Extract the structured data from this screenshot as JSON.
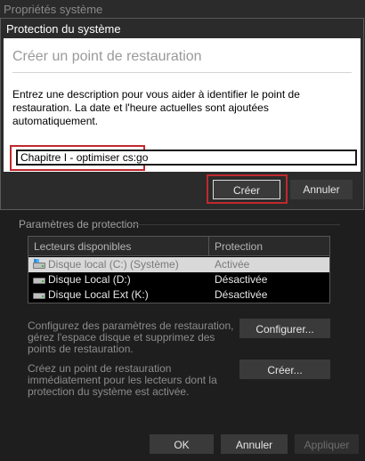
{
  "background_window": {
    "title": "Propriétés système",
    "group_label": "Paramètres de protection",
    "table": {
      "headers": [
        "Lecteurs disponibles",
        "Protection"
      ],
      "rows": [
        {
          "drive": "Disque local (C:) (Système)",
          "protection": "Activée",
          "icon": "system-drive-icon",
          "selected": true
        },
        {
          "drive": "Disque Local (D:)",
          "protection": "Désactivée",
          "icon": "drive-icon",
          "selected": false
        },
        {
          "drive": "Disque Local Ext (K:)",
          "protection": "Désactivée",
          "icon": "drive-icon",
          "selected": false
        }
      ]
    },
    "configure_text": "Configurez des paramètres de restauration, gérez l'espace disque et supprimez des points de restauration.",
    "configure_button": "Configurer...",
    "create_text": "Créez un point de restauration immédiatement pour les lecteurs dont la protection du système est activée.",
    "create_button": "Créer...",
    "ok_button": "OK",
    "cancel_button": "Annuler",
    "apply_button": "Appliquer"
  },
  "dialog": {
    "title": "Protection du système",
    "heading": "Créer un point de restauration",
    "description": "Entrez une description pour vous aider à identifier le point de restauration. La date et l'heure actuelles sont ajoutées automatiquement.",
    "input_value": "Chapitre I - optimiser cs:go",
    "create_button": "Créer",
    "cancel_button": "Annuler"
  },
  "colors": {
    "highlight": "#c0282d",
    "dark_bg": "#2b2b2b"
  }
}
